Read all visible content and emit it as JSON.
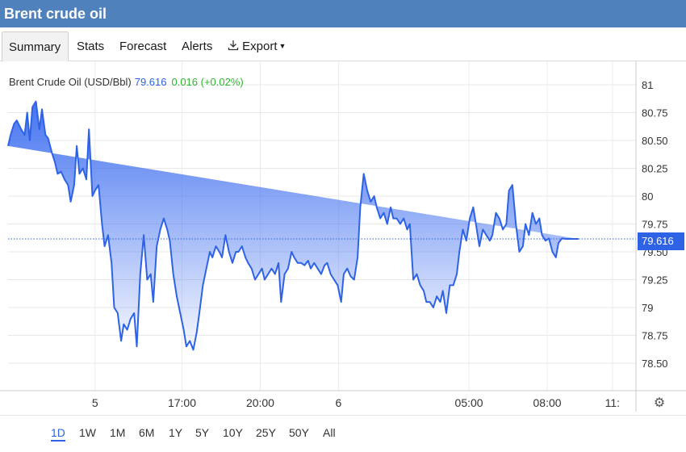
{
  "window": {
    "title": "Brent crude oil"
  },
  "tabs": [
    {
      "label": "Summary"
    },
    {
      "label": "Stats"
    },
    {
      "label": "Forecast"
    },
    {
      "label": "Alerts"
    },
    {
      "label": "Export"
    }
  ],
  "legend": {
    "instrument": "Brent Crude Oil (USD/Bbl)",
    "price": "79.616",
    "change": "0.016 (+0.02%)"
  },
  "current_price_label": "79.616",
  "time_ranges": [
    "1D",
    "1W",
    "1M",
    "6M",
    "1Y",
    "5Y",
    "10Y",
    "25Y",
    "50Y",
    "All"
  ],
  "active_range": "1D",
  "colors": {
    "line": "#2e63e6",
    "header": "#4f81bd",
    "positive": "#2db82d"
  },
  "icons": {
    "export": "download-icon",
    "settings": "gear-icon"
  },
  "chart_data": {
    "type": "area",
    "ylim": [
      78.3,
      81.05
    ],
    "yticks": [
      81,
      80.75,
      80.5,
      80.25,
      80,
      79.75,
      79.5,
      79.25,
      79,
      78.75,
      78.5
    ],
    "ytick_labels": [
      "81",
      "80.75",
      "80.50",
      "80.25",
      "80",
      "79.75",
      "79.50",
      "79.25",
      "79",
      "78.75",
      "78.50"
    ],
    "xticks": [
      {
        "pos": 10,
        "label": "5"
      },
      {
        "pos": 20,
        "label": "17:00"
      },
      {
        "pos": 29,
        "label": "20:00"
      },
      {
        "pos": 38,
        "label": "6"
      },
      {
        "pos": 53,
        "label": "05:00"
      },
      {
        "pos": 62,
        "label": "08:00"
      },
      {
        "pos": 69.5,
        "label": "11:"
      }
    ],
    "xlim": [
      0,
      71
    ],
    "reference_value": 79.616,
    "x": [
      0,
      0.3,
      0.7,
      1,
      1.5,
      1.9,
      2.2,
      2.5,
      2.8,
      3.2,
      3.6,
      3.9,
      4.3,
      4.6,
      5,
      5.4,
      5.7,
      6.1,
      6.5,
      6.9,
      7.2,
      7.6,
      7.9,
      8.2,
      8.6,
      9,
      9.3,
      9.7,
      10,
      10.4,
      10.8,
      11.1,
      11.5,
      11.9,
      12.2,
      12.6,
      13,
      13.3,
      13.7,
      14.1,
      14.5,
      14.8,
      15.2,
      15.6,
      16,
      16.4,
      16.7,
      17.1,
      17.5,
      17.9,
      18.3,
      18.6,
      19,
      19.4,
      19.8,
      20.2,
      20.5,
      20.9,
      21.3,
      21.7,
      22,
      22.4,
      22.8,
      23.2,
      23.5,
      23.9,
      24.3,
      24.6,
      25,
      25.4,
      25.8,
      26.2,
      26.5,
      26.9,
      27.3,
      27.6,
      28,
      28.4,
      28.8,
      29.2,
      29.5,
      29.9,
      30.3,
      30.7,
      31.1,
      31.4,
      31.8,
      32.2,
      32.6,
      32.9,
      33.3,
      33.7,
      34.1,
      34.5,
      34.8,
      35.2,
      35.6,
      36,
      36.4,
      36.7,
      37.1,
      37.5,
      37.9,
      38.3,
      38.6,
      39,
      39.4,
      39.8,
      40.2,
      40.5,
      40.9,
      41.3,
      41.7,
      42.1,
      42.4,
      42.8,
      43.2,
      43.6,
      44,
      44.3,
      44.7,
      45.1,
      45.5,
      45.9,
      46.2,
      46.6,
      47,
      47.4,
      47.8,
      48.1,
      48.5,
      48.9,
      49.3,
      49.7,
      50,
      50.4,
      50.8,
      51.2,
      51.6,
      51.9,
      52.3,
      52.7,
      53.1,
      53.5,
      53.8,
      54.2,
      54.6,
      55,
      55.4,
      55.7,
      56.1,
      56.5,
      56.9,
      57.3,
      57.6,
      58,
      58.4,
      58.8,
      59.2,
      59.5,
      59.9,
      60.3,
      60.7,
      61.1,
      61.4,
      61.8,
      62.2,
      62.6,
      63,
      63.3,
      63.7,
      64.1,
      64.5,
      64.9,
      65.2,
      65.6,
      66,
      66.4,
      66.8,
      67.1,
      67.5,
      67.9,
      68.3,
      68.7,
      69,
      69.4,
      69.8,
      70.2,
      70.6,
      71
    ],
    "values": [
      80.45,
      80.55,
      80.65,
      80.68,
      80.6,
      80.55,
      80.75,
      80.5,
      80.8,
      80.85,
      80.6,
      80.78,
      80.55,
      80.52,
      80.4,
      80.3,
      80.2,
      80.22,
      80.15,
      80.1,
      79.95,
      80.1,
      80.45,
      80.2,
      80.25,
      80.15,
      80.6,
      80.0,
      80.05,
      80.1,
      79.75,
      79.55,
      79.65,
      79.4,
      79.0,
      78.95,
      78.7,
      78.85,
      78.8,
      78.9,
      78.95,
      78.65,
      79.3,
      79.65,
      79.25,
      79.3,
      79.05,
      79.55,
      79.7,
      79.8,
      79.7,
      79.6,
      79.3,
      79.1,
      78.95,
      78.8,
      78.65,
      78.7,
      78.62,
      78.78,
      78.95,
      79.2,
      79.35,
      79.5,
      79.45,
      79.55,
      79.5,
      79.45,
      79.65,
      79.5,
      79.4,
      79.5,
      79.5,
      79.55,
      79.45,
      79.4,
      79.35,
      79.25,
      79.3,
      79.35,
      79.25,
      79.3,
      79.35,
      79.3,
      79.4,
      79.05,
      79.3,
      79.35,
      79.5,
      79.45,
      79.4,
      79.4,
      79.38,
      79.42,
      79.35,
      79.4,
      79.35,
      79.3,
      79.38,
      79.4,
      79.3,
      79.25,
      79.2,
      79.05,
      79.3,
      79.35,
      79.28,
      79.25,
      79.45,
      79.9,
      80.2,
      80.05,
      79.95,
      80.0,
      79.9,
      79.8,
      79.85,
      79.75,
      79.9,
      79.8,
      79.8,
      79.75,
      79.8,
      79.7,
      79.75,
      79.25,
      79.3,
      79.2,
      79.15,
      79.05,
      79.05,
      79.0,
      79.1,
      79.05,
      79.15,
      78.95,
      79.2,
      79.2,
      79.3,
      79.5,
      79.7,
      79.6,
      79.8,
      79.9,
      79.75,
      79.55,
      79.7,
      79.65,
      79.6,
      79.65,
      79.85,
      79.8,
      79.7,
      79.75,
      80.05,
      80.1,
      79.75,
      79.5,
      79.55,
      79.75,
      79.65,
      79.85,
      79.75,
      79.8,
      79.65,
      79.6,
      79.62,
      79.5,
      79.45,
      79.58,
      79.62,
      79.616,
      79.616,
      79.616,
      79.616,
      79.616
    ]
  }
}
